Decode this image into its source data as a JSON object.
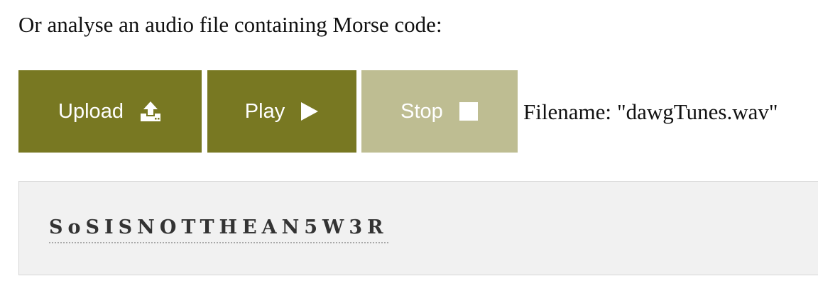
{
  "intro_text": "Or analyse an audio file containing Morse code:",
  "buttons": {
    "upload": {
      "label": "Upload",
      "icon": "upload-icon"
    },
    "play": {
      "label": "Play",
      "icon": "play-icon"
    },
    "stop": {
      "label": "Stop",
      "icon": "stop-icon"
    }
  },
  "file": {
    "label": "Filename:",
    "value": "\"dawgTunes.wav\""
  },
  "result": {
    "text": "SoSISNOTTHEAN5W3R"
  },
  "colors": {
    "button_active": "#787822",
    "button_disabled": "#bebd92",
    "result_background": "#f1f1f1"
  }
}
